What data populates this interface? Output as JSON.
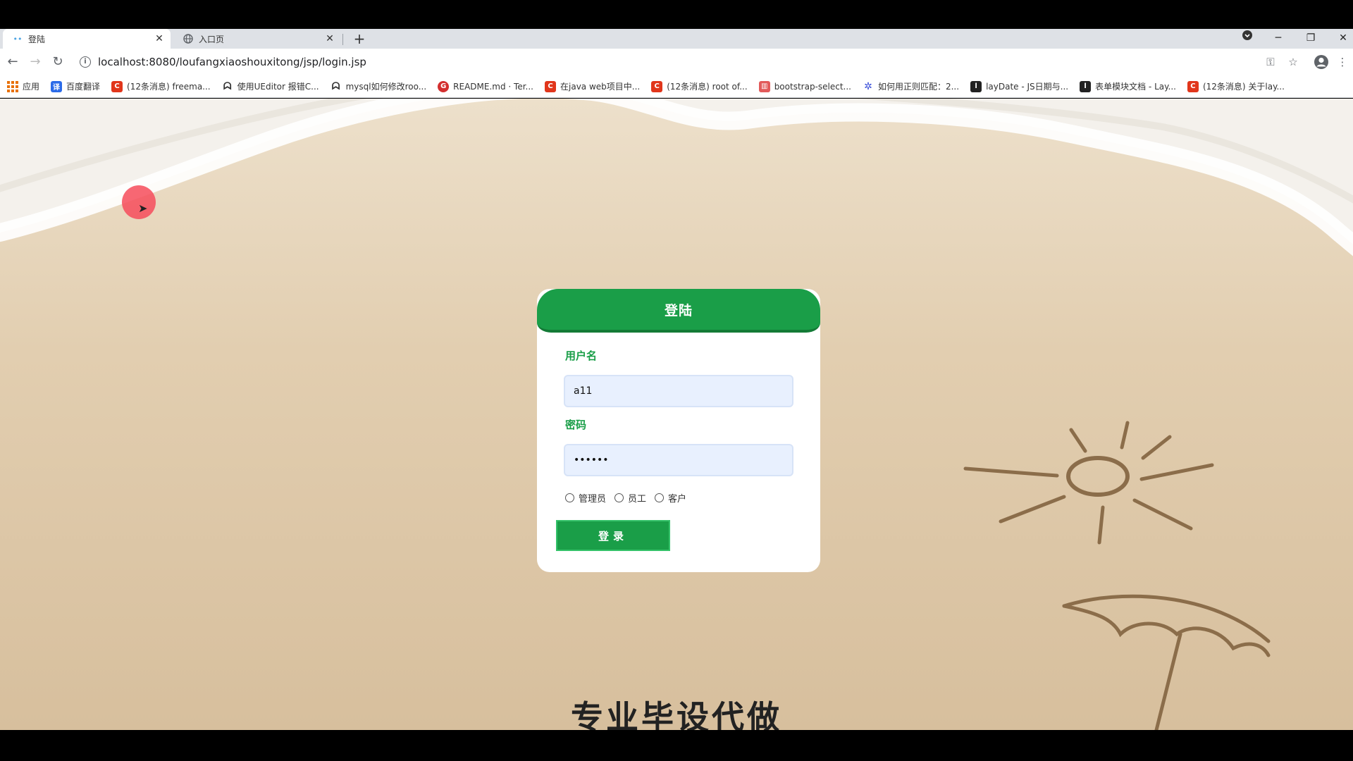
{
  "browser": {
    "tabs": [
      {
        "title": "登陆",
        "active": true
      },
      {
        "title": "入口页",
        "active": false
      }
    ],
    "url": "localhost:8080/loufangxiaoshouxitong/jsp/login.jsp",
    "bookmarks": [
      {
        "label": "应用",
        "icon": "apps-grid-icon"
      },
      {
        "label": "百度翻译",
        "icon": "baidu-translate-icon"
      },
      {
        "label": "(12条消息) freema...",
        "icon": "csdn-icon"
      },
      {
        "label": "使用UEditor 报错C...",
        "icon": "ueditor-icon"
      },
      {
        "label": "mysql如何修改roo...",
        "icon": "ueditor-icon"
      },
      {
        "label": "README.md · Ter...",
        "icon": "gitee-icon"
      },
      {
        "label": "在java web项目中...",
        "icon": "csdn-icon"
      },
      {
        "label": "(12条消息) root of...",
        "icon": "csdn-icon"
      },
      {
        "label": "bootstrap-select...",
        "icon": "bootstrap-icon"
      },
      {
        "label": "如何用正则匹配：2...",
        "icon": "regex-icon"
      },
      {
        "label": "layDate - JS日期与...",
        "icon": "layui-icon"
      },
      {
        "label": "表单模块文档 - Lay...",
        "icon": "layui-icon"
      },
      {
        "label": "(12条消息) 关于lay...",
        "icon": "csdn-icon"
      }
    ]
  },
  "login": {
    "title": "登陆",
    "username_label": "用户名",
    "username_value": "a11",
    "password_label": "密码",
    "password_value": "••••••",
    "roles": [
      "管理员",
      "员工",
      "客户"
    ],
    "submit_label": "登录"
  },
  "overlay": {
    "subtitle": "专业毕设代做"
  },
  "colors": {
    "accent": "#1a9e48",
    "input_bg": "#e8f0fe",
    "cursor_highlight": "#f64c5c"
  }
}
